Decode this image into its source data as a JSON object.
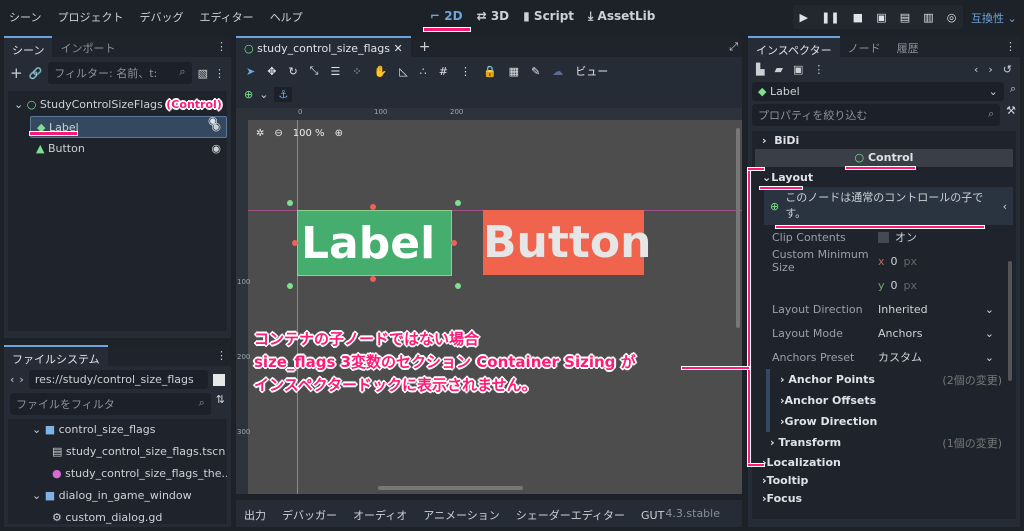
{
  "menu": [
    "シーン",
    "プロジェクト",
    "デバッグ",
    "エディター",
    "ヘルプ"
  ],
  "workspaces": [
    {
      "label": "2D",
      "icon": "2d-icon"
    },
    {
      "label": "3D",
      "icon": "3d-icon"
    },
    {
      "label": "Script",
      "icon": "script-icon"
    },
    {
      "label": "AssetLib",
      "icon": "assetlib-icon"
    }
  ],
  "compat": "互換性",
  "scene_dock": {
    "tabs": [
      "シーン",
      "インポート"
    ],
    "filter_placeholder": "フィルター: 名前、t:",
    "root": "StudyControlSizeFlags",
    "children": [
      "Label",
      "Button"
    ]
  },
  "filesystem": {
    "tab": "ファイルシステム",
    "path": "res://study/control_size_flags",
    "filter_placeholder": "ファイルをフィルタ",
    "items": [
      "control_size_flags",
      "study_control_size_flags.tscn",
      "study_control_size_flags_the...",
      "dialog_in_game_window",
      "custom_dialog.gd"
    ]
  },
  "editor": {
    "tab": "study_control_size_flags",
    "view_menu": "ビュー",
    "zoom": "100 %",
    "ruler_x": [
      "0",
      "100",
      "200"
    ],
    "ruler_y": [
      "100",
      "200",
      "300"
    ],
    "label_text": "Label",
    "button_text": "Button",
    "label_color": "#45ae6e",
    "button_color": "#f0644e"
  },
  "bottom": {
    "tabs": [
      "出力",
      "デバッガー",
      "オーディオ",
      "アニメーション",
      "シェーダーエディター",
      "GUT"
    ],
    "version": "4.3.stable"
  },
  "inspector": {
    "tabs": [
      "インスペクター",
      "ノード",
      "履歴"
    ],
    "node": "Label",
    "filter_placeholder": "プロパティを絞り込む",
    "bidi": "BiDi",
    "class": "Control",
    "layout": "Layout",
    "info": "このノードは通常のコントロールの子です。",
    "clip_label": "Clip Contents",
    "clip_value": "オン",
    "min_size_label": "Custom Minimum Size",
    "min_x": "0",
    "min_y": "0",
    "unit": "px",
    "x": "x",
    "y": "y",
    "dir_label": "Layout Direction",
    "dir_value": "Inherited",
    "mode_label": "Layout Mode",
    "mode_value": "Anchors",
    "preset_label": "Anchors Preset",
    "preset_value": "カスタム",
    "anchor_points": "Anchor Points",
    "anchor_points_changes": "(2個の変更)",
    "anchor_offsets": "Anchor Offsets",
    "grow": "Grow Direction",
    "transform": "Transform",
    "transform_changes": "(1個の変更)",
    "sections": [
      "Localization",
      "Tooltip",
      "Focus"
    ]
  },
  "annotations": {
    "control": "(Control)",
    "note": [
      "コンテナの子ノードではない場合",
      "size_flags 3変数のセクション Container Sizing が",
      "インスペクタードックに表示されません。"
    ],
    "color": "#ff1a75"
  }
}
